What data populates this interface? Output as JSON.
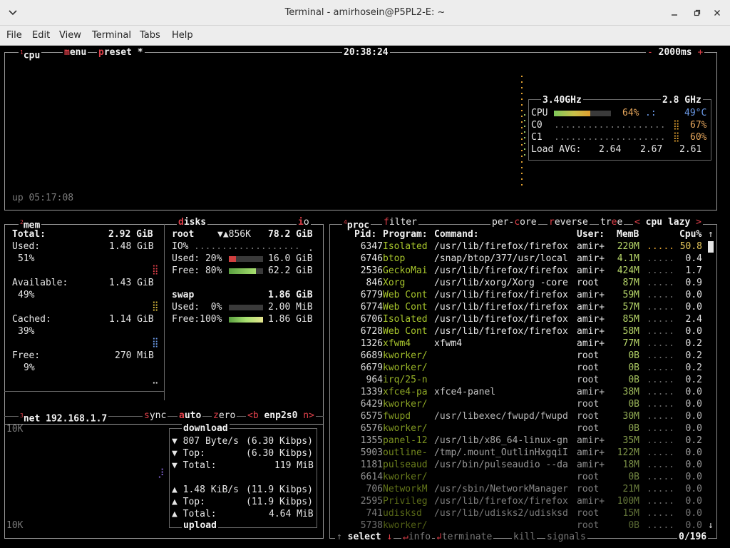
{
  "window": {
    "title": "Terminal - amirhosein@P5PL2-E: ~"
  },
  "menu": [
    "File",
    "Edit",
    "View",
    "Terminal",
    "Tabs",
    "Help"
  ],
  "cpu": {
    "tab_num": "1",
    "tab": "cpu",
    "menu": "menu",
    "preset": "preset *",
    "clock": "20:38:24",
    "interval": "2000ms",
    "minus": "-",
    "plus": "+",
    "uptime": "up 05:17:08",
    "freq_left": "3.40GHz",
    "freq_right": "2.8 GHz",
    "cpu_label": "CPU",
    "cpu_pct": "64%",
    "cpu_temp": "49°C",
    "cpu_meter": 0.64,
    "c0_label": "C0",
    "c0_pct": "67%",
    "c1_label": "C1",
    "c1_pct": "60%",
    "load_label": "Load AVG:",
    "load": [
      "2.64",
      "2.67",
      "2.61"
    ]
  },
  "mem": {
    "tab_num": "2",
    "tab": "mem",
    "total_label": "Total:",
    "total": "2.92 GiB",
    "used_label": "Used:",
    "used": "1.48 GiB",
    "used_pct": "51%",
    "avail_label": "Available:",
    "avail": "1.43 GiB",
    "avail_pct": "49%",
    "cached_label": "Cached:",
    "cached": "1.14 GiB",
    "cached_pct": "39%",
    "free_label": "Free:",
    "free": "270 MiB",
    "free_pct": "9%"
  },
  "disks": {
    "tab": "disks",
    "io_tab": "io",
    "root_label": "root",
    "root_io": "▼▲856K",
    "root_total": "78.2 GiB",
    "io_label": "IO%",
    "root_used_label": "Used: 20%",
    "root_used": "16.0 GiB",
    "root_used_meter": 0.2,
    "root_free_label": "Free: 80%",
    "root_free": "62.2 GiB",
    "root_free_meter": 0.8,
    "swap_label": "swap",
    "swap_total": "1.86 GiB",
    "swap_used_label": "Used:  0%",
    "swap_used": "2.00 MiB",
    "swap_free_label": "Free:100%",
    "swap_free": "1.86 GiB",
    "swap_free_meter": 1.0
  },
  "net": {
    "tab_num": "3",
    "tab": "net",
    "ip": "192.168.1.7",
    "sync": "sync",
    "auto": "auto",
    "zero": "zero",
    "prev": "<b",
    "iface": "enp2s0",
    "next": "n>",
    "scale_top": "10K",
    "scale_bottom": "10K",
    "download_label": "download",
    "dl_rate": "807 Byte/s",
    "dl_rate_bits": "(6.30 Kibps)",
    "dl_top_label": "Top:",
    "dl_top": "(6.30 Kibps)",
    "dl_total_label": "Total:",
    "dl_total": "119 MiB",
    "ul_rate": "1.48 KiB/s",
    "ul_rate_bits": "(11.9 Kibps)",
    "ul_top_label": "Top:",
    "ul_top": "(11.9 Kibps)",
    "ul_total_label": "Total:",
    "ul_total": "4.64 MiB",
    "upload_label": "upload"
  },
  "proc": {
    "tab_num": "4",
    "tab": "proc",
    "filter": "filter",
    "per_core": "per-core",
    "reverse": "reverse",
    "tree": "tree",
    "sort_prev": "<",
    "sort": "cpu lazy",
    "sort_next": ">",
    "headers": {
      "pid": "Pid:",
      "program": "Program:",
      "command": "Command:",
      "user": "User:",
      "mem": "MemB",
      "cpu": "Cpu%"
    },
    "rows": [
      {
        "pid": "6347",
        "program": "Isolated",
        "command": "/usr/lib/firefox/firefox",
        "user": "amir+",
        "mem": "220M",
        "cpu": "50.8"
      },
      {
        "pid": "6746",
        "program": "btop",
        "command": "/snap/btop/377/usr/local",
        "user": "amir+",
        "mem": "4.1M",
        "cpu": "0.4"
      },
      {
        "pid": "2536",
        "program": "GeckoMai",
        "command": "/usr/lib/firefox/firefox",
        "user": "amir+",
        "mem": "424M",
        "cpu": "1.7"
      },
      {
        "pid": "846",
        "program": "Xorg",
        "command": "/usr/lib/xorg/Xorg -core",
        "user": "root",
        "mem": "87M",
        "cpu": "0.9"
      },
      {
        "pid": "6779",
        "program": "Web Cont",
        "command": "/usr/lib/firefox/firefox",
        "user": "amir+",
        "mem": "59M",
        "cpu": "0.0"
      },
      {
        "pid": "6774",
        "program": "Web Cont",
        "command": "/usr/lib/firefox/firefox",
        "user": "amir+",
        "mem": "57M",
        "cpu": "0.0"
      },
      {
        "pid": "6706",
        "program": "Isolated",
        "command": "/usr/lib/firefox/firefox",
        "user": "amir+",
        "mem": "85M",
        "cpu": "2.4"
      },
      {
        "pid": "6728",
        "program": "Web Cont",
        "command": "/usr/lib/firefox/firefox",
        "user": "amir+",
        "mem": "58M",
        "cpu": "0.0"
      },
      {
        "pid": "1326",
        "program": "xfwm4",
        "command": "xfwm4",
        "user": "amir+",
        "mem": "77M",
        "cpu": "0.2"
      },
      {
        "pid": "6689",
        "program": "kworker/",
        "command": "",
        "user": "root",
        "mem": "0B",
        "cpu": "0.2"
      },
      {
        "pid": "6679",
        "program": "kworker/",
        "command": "",
        "user": "root",
        "mem": "0B",
        "cpu": "0.2"
      },
      {
        "pid": "964",
        "program": "irq/25-n",
        "command": "",
        "user": "root",
        "mem": "0B",
        "cpu": "0.2"
      },
      {
        "pid": "1339",
        "program": "xfce4-pa",
        "command": "xfce4-panel",
        "user": "amir+",
        "mem": "38M",
        "cpu": "0.0"
      },
      {
        "pid": "6429",
        "program": "kworker/",
        "command": "",
        "user": "root",
        "mem": "0B",
        "cpu": "0.0"
      },
      {
        "pid": "6575",
        "program": "fwupd",
        "command": "/usr/libexec/fwupd/fwupd",
        "user": "root",
        "mem": "30M",
        "cpu": "0.0"
      },
      {
        "pid": "6576",
        "program": "kworker/",
        "command": "",
        "user": "root",
        "mem": "0B",
        "cpu": "0.0"
      },
      {
        "pid": "1355",
        "program": "panel-12",
        "command": "/usr/lib/x86_64-linux-gn",
        "user": "amir+",
        "mem": "35M",
        "cpu": "0.2"
      },
      {
        "pid": "5903",
        "program": "outline-",
        "command": "/tmp/.mount_OutlinHxgqiI",
        "user": "amir+",
        "mem": "122M",
        "cpu": "0.0"
      },
      {
        "pid": "1181",
        "program": "pulseaud",
        "command": "/usr/bin/pulseaudio --da",
        "user": "amir+",
        "mem": "18M",
        "cpu": "0.0"
      },
      {
        "pid": "6614",
        "program": "kworker/",
        "command": "",
        "user": "root",
        "mem": "0B",
        "cpu": "0.0"
      },
      {
        "pid": "706",
        "program": "NetworkM",
        "command": "/usr/sbin/NetworkManager",
        "user": "root",
        "mem": "21M",
        "cpu": "0.0"
      },
      {
        "pid": "2595",
        "program": "Privileg",
        "command": "/usr/lib/firefox/firefox",
        "user": "amir+",
        "mem": "100M",
        "cpu": "0.0"
      },
      {
        "pid": "741",
        "program": "udisksd",
        "command": "/usr/lib/udisks2/udisksd",
        "user": "root",
        "mem": "15M",
        "cpu": "0.0"
      },
      {
        "pid": "5738",
        "program": "kworker/",
        "command": "",
        "user": "root",
        "mem": "0B",
        "cpu": "0.0"
      }
    ],
    "footer": {
      "select": "select",
      "info": "info",
      "terminate": "terminate",
      "kill": "kill",
      "signals": "signals",
      "count": "0/196"
    }
  },
  "colors": {
    "accent": "#e0404a",
    "program_green": "#a8c62c",
    "meter_green": "#7ec85a",
    "warn_orange": "#e7a75c",
    "temp_blue": "#6b9ae8"
  }
}
